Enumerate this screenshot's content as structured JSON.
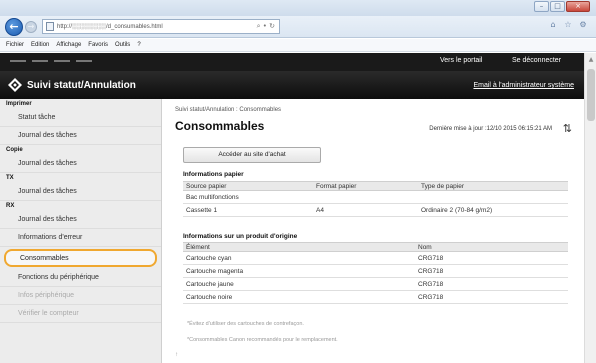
{
  "browser": {
    "url": "http://░░░░░░░░/d_consumables.html",
    "nav_back_icon": "arrow-left-icon",
    "nav_forward_icon": "arrow-right-icon",
    "address_tools": "⌕ • ↻",
    "right_tools": [
      "home-icon",
      "star-icon",
      "gear-icon"
    ],
    "menu": [
      "Fichier",
      "Edition",
      "Affichage",
      "Favoris",
      "Outils",
      "?"
    ]
  },
  "header": {
    "portal_link": "Vers le portail",
    "logout_link": "Se déconnecter",
    "app_title": "Suivi statut/Annulation",
    "admin_link": "Email à l'administrateur système"
  },
  "sidebar": {
    "sections": [
      {
        "title": "Imprimer",
        "items": [
          "Statut tâche",
          "Journal des tâches"
        ]
      },
      {
        "title": "Copie",
        "items": [
          "Journal des tâches"
        ]
      },
      {
        "title": "TX",
        "items": [
          "Journal des tâches"
        ]
      },
      {
        "title": "RX",
        "items": [
          "Journal des tâches"
        ]
      }
    ],
    "extra_items": [
      "Informations d'erreur",
      "Consommables",
      "Fonctions du périphérique",
      "Infos périphérique",
      "Vérifier le compteur"
    ]
  },
  "main": {
    "breadcrumb": "Suivi statut/Annulation : Consommables",
    "title": "Consommables",
    "last_update": "Dernière mise à jour :12/10 2015 06:15:21 AM",
    "purchase_button": "Accéder au site d'achat",
    "paper_info": {
      "title": "Informations papier",
      "columns": [
        "Source papier",
        "Format papier",
        "Type de papier"
      ],
      "rows": [
        [
          "Bac multifonctions",
          "",
          ""
        ],
        [
          "Cassette 1",
          "A4",
          "Ordinaire 2 (70-84 g/m2)"
        ]
      ]
    },
    "cartridge_info": {
      "title": "Informations sur un produit d'origine",
      "columns": [
        "Élément",
        "Nom"
      ],
      "rows": [
        [
          "Cartouche cyan",
          "CRG718"
        ],
        [
          "Cartouche magenta",
          "CRG718"
        ],
        [
          "Cartouche jaune",
          "CRG718"
        ],
        [
          "Cartouche noire",
          "CRG718"
        ]
      ]
    },
    "notes": [
      "*Évitez d'utiliser des cartouches de contrefaçon.",
      "*Consommables Canon recommandés pour le remplacement."
    ],
    "bottom_mark": "↑"
  }
}
